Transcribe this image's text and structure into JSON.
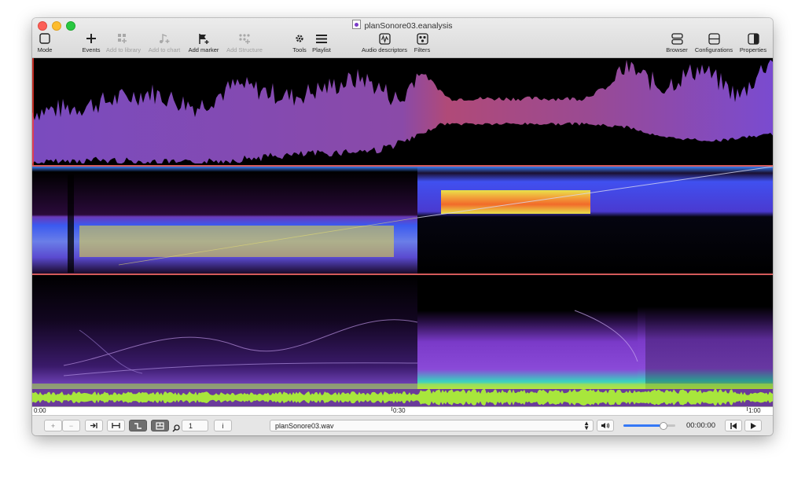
{
  "window": {
    "title": "planSonore03.eanalysis"
  },
  "toolbar": {
    "mode": "Mode",
    "events": "Events",
    "add_library": "Add to library",
    "add_chart": "Add to chart",
    "add_marker": "Add marker",
    "add_structure": "Add Structure",
    "tools": "Tools",
    "playlist": "Playlist",
    "audio_descriptors": "Audio descriptors",
    "filters": "Filters",
    "browser": "Browser",
    "configurations": "Configurations",
    "properties": "Properties"
  },
  "timeline": {
    "t0": "0:00",
    "t1": "0:30",
    "t2": "1:00"
  },
  "bottom": {
    "plus": "+",
    "minus": "−",
    "zoom_value": "1",
    "info": "i",
    "file": "planSonore03.wav",
    "time": "00:00:00",
    "volume_fraction": 0.78
  },
  "colors": {
    "accent": "#3478f6",
    "waveform": "#a8e63c",
    "envelope": "#7a4bbf",
    "marker": "#ff3b30"
  }
}
